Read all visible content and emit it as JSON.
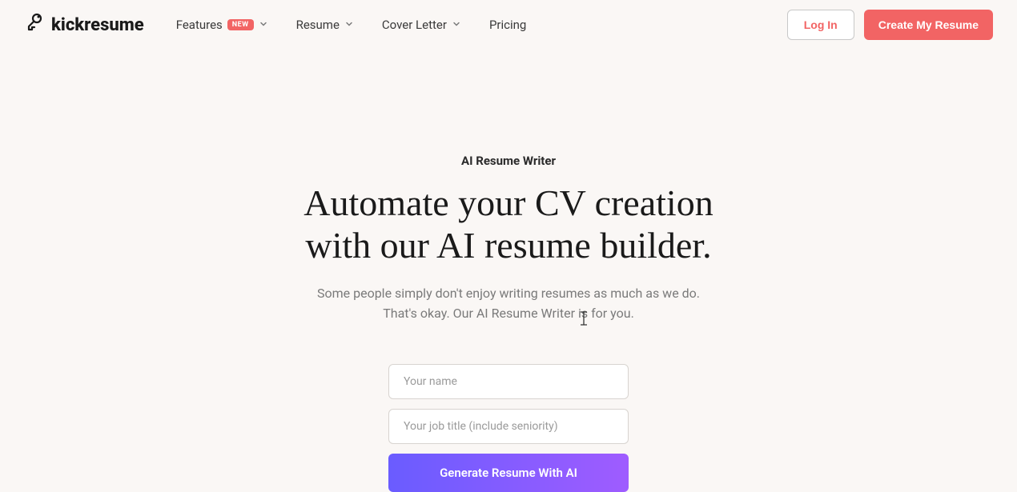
{
  "header": {
    "logo_text": "kickresume",
    "nav": {
      "features": "Features",
      "features_badge": "NEW",
      "resume": "Resume",
      "cover_letter": "Cover Letter",
      "pricing": "Pricing"
    },
    "login_label": "Log In",
    "create_label": "Create My Resume"
  },
  "main": {
    "eyebrow": "AI Resume Writer",
    "headline_line1": "Automate your CV creation",
    "headline_line2": "with our AI resume builder.",
    "subhead_line1": "Some people simply don't enjoy writing resumes as much as we do.",
    "subhead_line2": "That's okay. Our AI Resume Writer is for you.",
    "form": {
      "name_placeholder": "Your name",
      "title_placeholder": "Your job title (include seniority)",
      "generate_label": "Generate Resume With AI"
    }
  }
}
